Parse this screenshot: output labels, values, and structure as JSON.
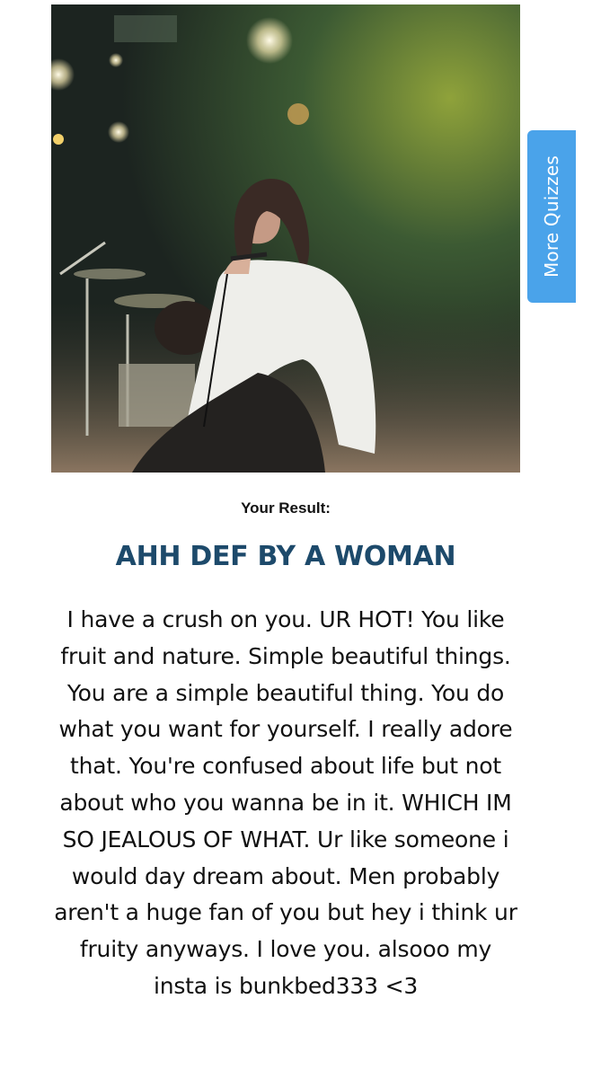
{
  "side_tab": {
    "label": "More Quizzes"
  },
  "result": {
    "label": "Your Result:",
    "title": "AHH DEF BY A WOMAN",
    "description": "I have a crush on you. UR HOT! You like fruit and nature. Simple beautiful things. You are a simple beautiful thing. You do what you want for yourself. I really adore that. You're confused about life but not about who you wanna be in it. WHICH IM SO JEALOUS OF WHAT. Ur like someone i would day dream about. Men probably aren't a huge fan of you but hey i think ur fruity anyways. I love you. alsooo my insta is bunkbed333 <3"
  },
  "colors": {
    "tab_background": "#4aa3ea",
    "title_color": "#1d4a6b"
  }
}
